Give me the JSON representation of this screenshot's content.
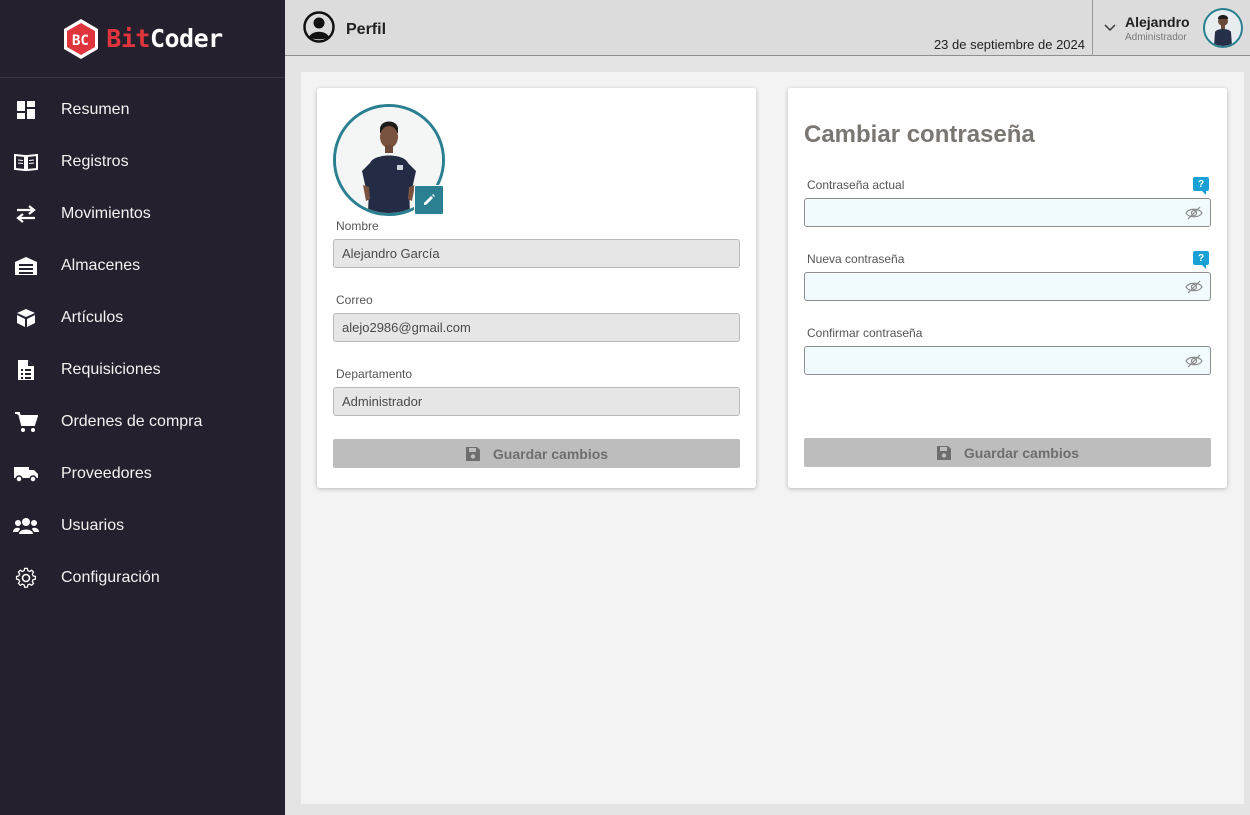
{
  "brand": {
    "bit": "Bit",
    "coder": "Coder",
    "accent": "#e0353d"
  },
  "sidebar": {
    "items": [
      {
        "label": "Resumen",
        "icon": "dashboard-icon"
      },
      {
        "label": "Registros",
        "icon": "book-icon"
      },
      {
        "label": "Movimientos",
        "icon": "swap-arrows-icon"
      },
      {
        "label": "Almacenes",
        "icon": "warehouse-icon"
      },
      {
        "label": "Artículos",
        "icon": "box-icon"
      },
      {
        "label": "Requisiciones",
        "icon": "document-list-icon"
      },
      {
        "label": "Ordenes de compra",
        "icon": "cart-icon"
      },
      {
        "label": "Proveedores",
        "icon": "truck-icon"
      },
      {
        "label": "Usuarios",
        "icon": "users-icon"
      },
      {
        "label": "Configuración",
        "icon": "gear-icon"
      }
    ]
  },
  "header": {
    "title": "Perfil",
    "date": "23 de septiembre de 2024",
    "user_name": "Alejandro",
    "user_role": "Administrador"
  },
  "profile": {
    "name_label": "Nombre",
    "name_value": "Alejandro García",
    "email_label": "Correo",
    "email_value": "alejo2986@gmail.com",
    "department_label": "Departamento",
    "department_value": "Administrador",
    "save_label": "Guardar cambios"
  },
  "password": {
    "title": "Cambiar contraseña",
    "current_label": "Contraseña actual",
    "new_label": "Nueva contraseña",
    "confirm_label": "Confirmar contraseña",
    "help_symbol": "?",
    "save_label": "Guardar cambios"
  },
  "colors": {
    "sidebar": "#24202d",
    "accent_teal": "#2a7f91",
    "help_blue": "#1aa0d4"
  }
}
